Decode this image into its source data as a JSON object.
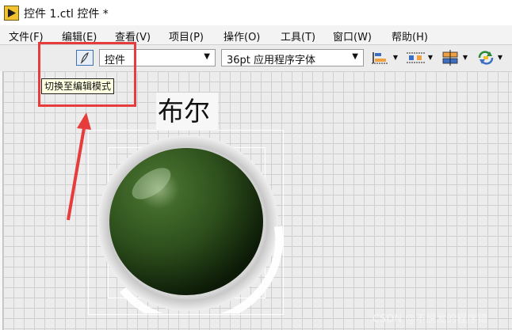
{
  "window": {
    "title": "控件 1.ctl 控件 *"
  },
  "menu": [
    {
      "label": "文件(F)"
    },
    {
      "label": "编辑(E)"
    },
    {
      "label": "查看(V)"
    },
    {
      "label": "项目(P)"
    },
    {
      "label": "操作(O)"
    },
    {
      "label": "工具(T)"
    },
    {
      "label": "窗口(W)"
    },
    {
      "label": "帮助(H)"
    }
  ],
  "toolbar": {
    "mode_dropdown": {
      "value": "控件"
    },
    "font_dropdown": {
      "value": "36pt 应用程序字体"
    },
    "tools": [
      {
        "icon": "align-objects-icon"
      },
      {
        "icon": "distribute-objects-icon"
      },
      {
        "icon": "resize-objects-icon"
      },
      {
        "icon": "reorder-icon"
      }
    ]
  },
  "tooltip": {
    "text": "切换至编辑模式"
  },
  "control": {
    "label": "布尔",
    "led_color": "#2d4f1c"
  },
  "colors": {
    "annotation": "#e63c3c",
    "toolbar_bg": "#ececec",
    "grid_bg": "#ececec"
  },
  "watermark": {
    "text": "CSDN @不脱发的程序猿"
  }
}
